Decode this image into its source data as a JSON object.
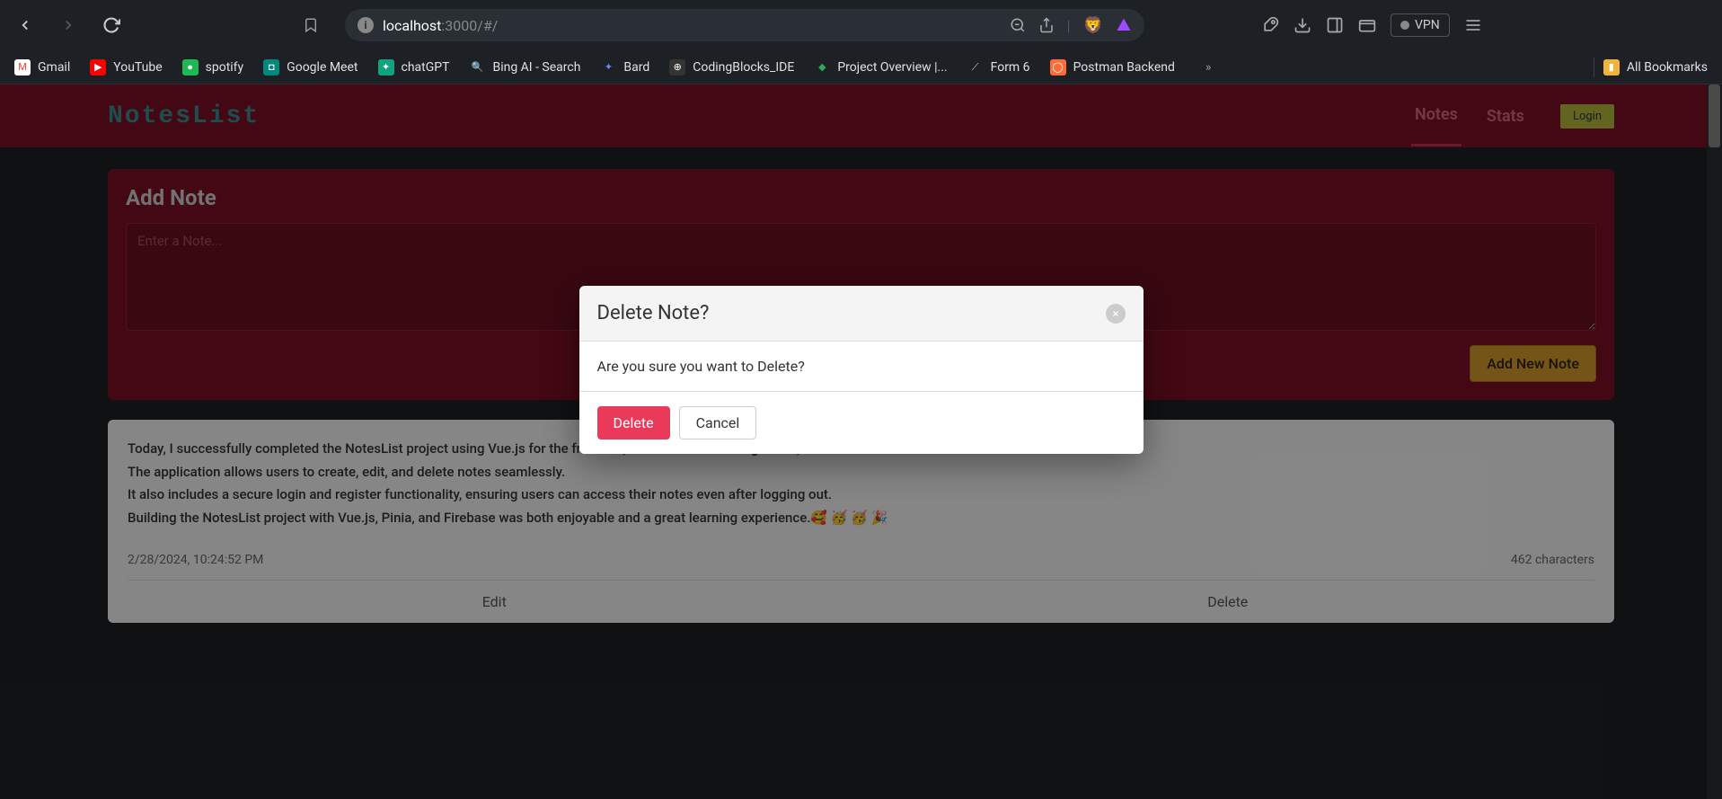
{
  "browser": {
    "url_host": "localhost",
    "url_path": ":3000/#/",
    "vpn_label": "VPN"
  },
  "bookmarks": [
    {
      "label": "Gmail",
      "icon_bg": "#fff",
      "icon_text": "M",
      "icon_color": "#ea4335"
    },
    {
      "label": "YouTube",
      "icon_bg": "#ff0000",
      "icon_text": "▶",
      "icon_color": "#fff"
    },
    {
      "label": "spotify",
      "icon_bg": "#1db954",
      "icon_text": "●",
      "icon_color": "#fff"
    },
    {
      "label": "Google Meet",
      "icon_bg": "#00897b",
      "icon_text": "◘",
      "icon_color": "#fff"
    },
    {
      "label": "chatGPT",
      "icon_bg": "#10a37f",
      "icon_text": "✦",
      "icon_color": "#fff"
    },
    {
      "label": "Bing AI - Search",
      "icon_bg": "transparent",
      "icon_text": "🔍",
      "icon_color": "#4aa0ff"
    },
    {
      "label": "Bard",
      "icon_bg": "transparent",
      "icon_text": "✦",
      "icon_color": "#6a8aff"
    },
    {
      "label": "CodingBlocks_IDE",
      "icon_bg": "#333",
      "icon_text": "⊕",
      "icon_color": "#fff"
    },
    {
      "label": "Project Overview |...",
      "icon_bg": "transparent",
      "icon_text": "◆",
      "icon_color": "#2aaa5a"
    },
    {
      "label": "Form 6",
      "icon_bg": "transparent",
      "icon_text": "⟋",
      "icon_color": "#ccc"
    },
    {
      "label": "Postman Backend",
      "icon_bg": "#ff6c37",
      "icon_text": "◯",
      "icon_color": "#fff"
    }
  ],
  "all_bookmarks_label": "All Bookmarks",
  "app": {
    "logo": "NotesList",
    "nav": {
      "notes": "Notes",
      "stats": "Stats"
    },
    "login": "Login"
  },
  "add_note": {
    "title": "Add Note",
    "placeholder": "Enter a Note...",
    "button": "Add New Note"
  },
  "note": {
    "body": "Today, I successfully completed the NotesList project using Vue.js for the frontend, Pinia for state management, and Firebase as the backend database.\nThe application allows users to create, edit, and delete notes seamlessly.\nIt also includes a secure login and register functionality, ensuring users can access their notes even after logging out.\nBuilding the NotesList project with Vue.js, Pinia, and Firebase was both enjoyable and a great learning experience.🥰 🥳 🥳 🎉",
    "timestamp": "2/28/2024, 10:24:52 PM",
    "char_count": "462 characters",
    "edit": "Edit",
    "delete": "Delete"
  },
  "modal": {
    "title": "Delete Note?",
    "body": "Are you sure you want to Delete?",
    "delete": "Delete",
    "cancel": "Cancel"
  }
}
